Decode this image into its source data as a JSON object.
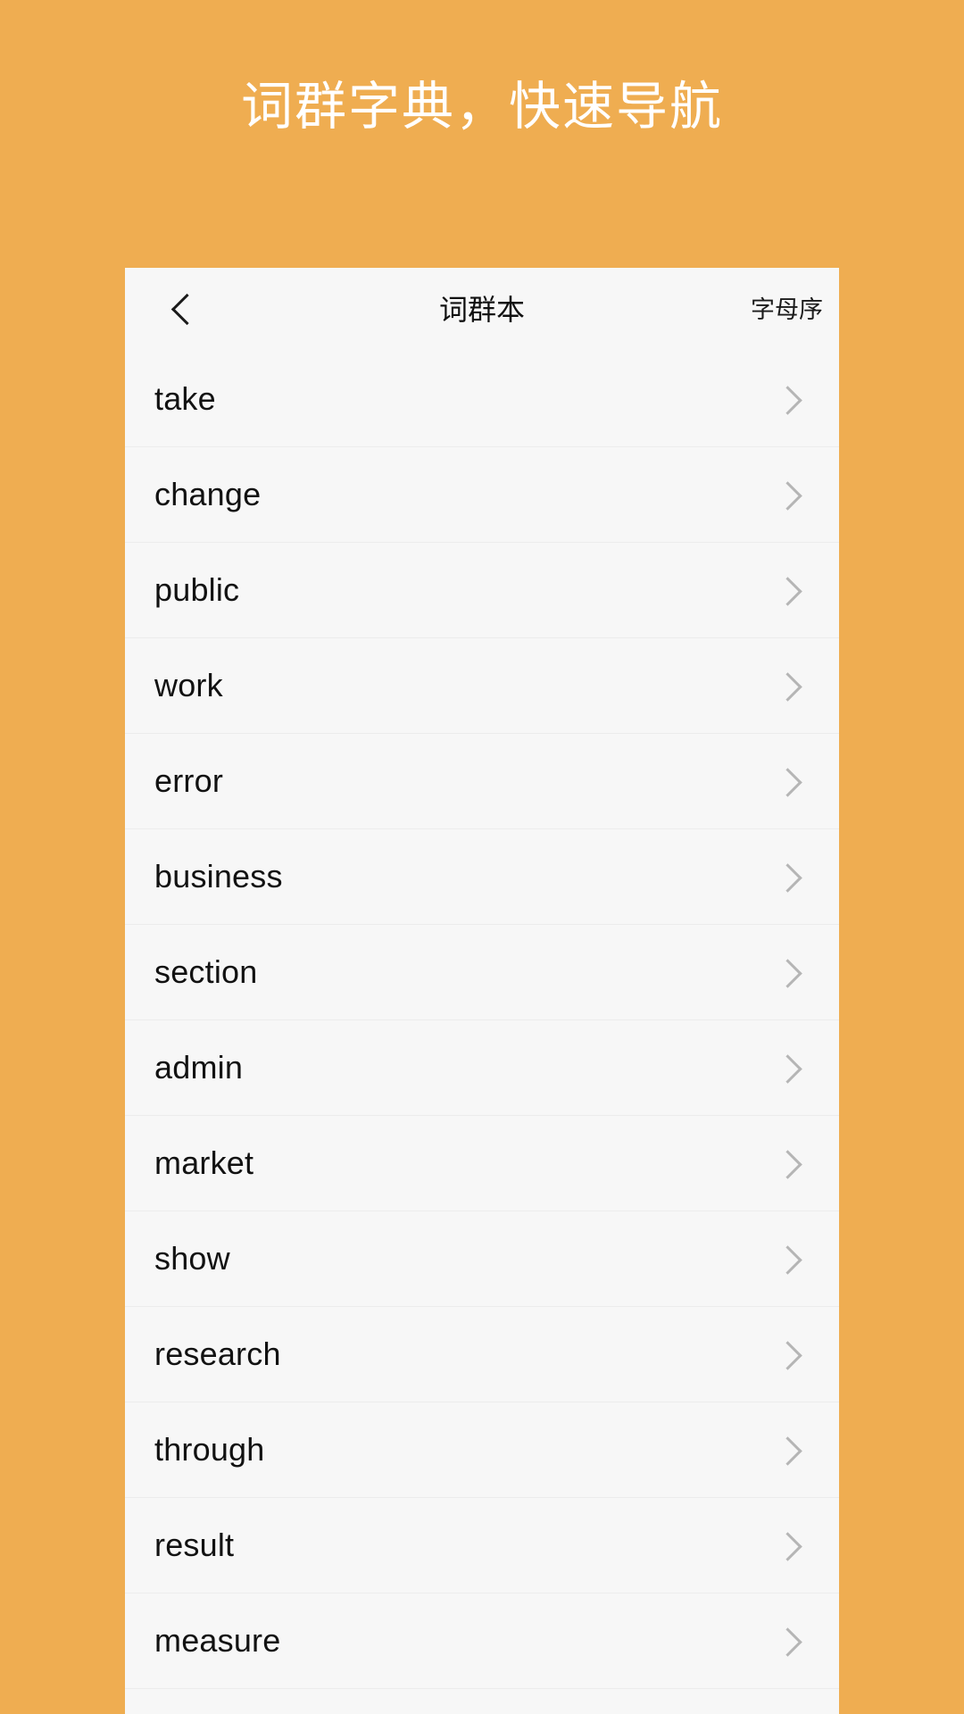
{
  "promo": {
    "headline": "词群字典，快速导航",
    "background_color": "#efad51",
    "text_color": "#ffffff"
  },
  "card": {
    "background_color": "#f7f7f7"
  },
  "navbar": {
    "back_icon": "chevron-left-icon",
    "title": "词群本",
    "action_label": "字母序"
  },
  "list": {
    "chevron_icon": "chevron-right-icon",
    "items": [
      {
        "label": "take"
      },
      {
        "label": "change"
      },
      {
        "label": "public"
      },
      {
        "label": "work"
      },
      {
        "label": "error"
      },
      {
        "label": "business"
      },
      {
        "label": "section"
      },
      {
        "label": "admin"
      },
      {
        "label": "market"
      },
      {
        "label": "show"
      },
      {
        "label": "research"
      },
      {
        "label": "through"
      },
      {
        "label": "result"
      },
      {
        "label": "measure"
      }
    ]
  }
}
